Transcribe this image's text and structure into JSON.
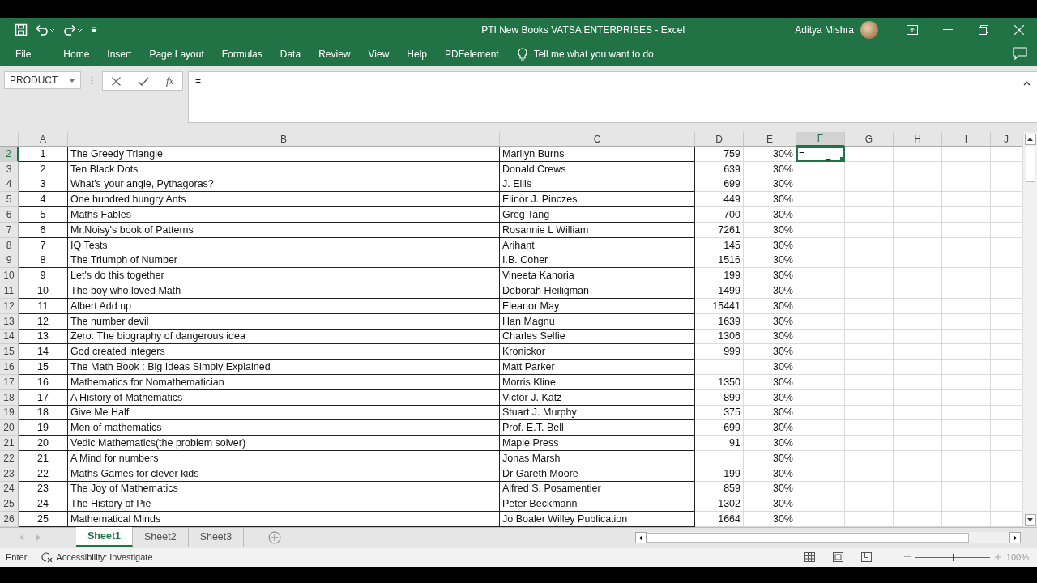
{
  "window": {
    "title": "PTI New Books VATSA ENTERPRISES  -  Excel",
    "user": "Aditya Mishra"
  },
  "ribbon_tabs": [
    {
      "label": "File"
    },
    {
      "label": "Home"
    },
    {
      "label": "Insert"
    },
    {
      "label": "Page Layout"
    },
    {
      "label": "Formulas"
    },
    {
      "label": "Data"
    },
    {
      "label": "Review"
    },
    {
      "label": "View"
    },
    {
      "label": "Help"
    },
    {
      "label": "PDFelement"
    }
  ],
  "tell_me": {
    "placeholder": "Tell me what you want to do"
  },
  "formula_bar": {
    "name_box": "PRODUCT",
    "function_label": "fx",
    "value": "="
  },
  "columns": [
    {
      "label": "A",
      "selected": false
    },
    {
      "label": "B",
      "selected": false
    },
    {
      "label": "C",
      "selected": false
    },
    {
      "label": "D",
      "selected": false
    },
    {
      "label": "E",
      "selected": false
    },
    {
      "label": "F",
      "selected": true
    },
    {
      "label": "G",
      "selected": false
    },
    {
      "label": "H",
      "selected": false
    },
    {
      "label": "I",
      "selected": false
    },
    {
      "label": "J",
      "selected": false
    }
  ],
  "active_cell": {
    "value": "="
  },
  "rows": [
    {
      "number": "2",
      "selected": true,
      "cells": {
        "a": "1",
        "b": "The Greedy Triangle",
        "c": "Marilyn Burns",
        "d": "759",
        "e": "30%"
      }
    },
    {
      "number": "3",
      "selected": false,
      "cells": {
        "a": "2",
        "b": "Ten Black Dots",
        "c": "Donald Crews",
        "d": "639",
        "e": "30%"
      }
    },
    {
      "number": "4",
      "selected": false,
      "cells": {
        "a": "3",
        "b": "What's your angle, Pythagoras?",
        "c": "J. Ellis",
        "d": "699",
        "e": "30%"
      }
    },
    {
      "number": "5",
      "selected": false,
      "cells": {
        "a": "4",
        "b": "One hundred hungry Ants",
        "c": "Elinor J. Pinczes",
        "d": "449",
        "e": "30%"
      }
    },
    {
      "number": "6",
      "selected": false,
      "cells": {
        "a": "5",
        "b": "Maths Fables",
        "c": "Greg Tang",
        "d": "700",
        "e": "30%"
      }
    },
    {
      "number": "7",
      "selected": false,
      "cells": {
        "a": "6",
        "b": "Mr.Noisy's book of Patterns",
        "c": "Rosannie L William",
        "d": "7261",
        "e": "30%"
      }
    },
    {
      "number": "8",
      "selected": false,
      "cells": {
        "a": "7",
        "b": "IQ Tests",
        "c": "Arihant",
        "d": "145",
        "e": "30%"
      }
    },
    {
      "number": "9",
      "selected": false,
      "cells": {
        "a": "8",
        "b": "The Triumph of Number",
        "c": "I.B. Coher",
        "d": "1516",
        "e": "30%"
      }
    },
    {
      "number": "10",
      "selected": false,
      "cells": {
        "a": "9",
        "b": "Let's do this together",
        "c": "Vineeta Kanoria",
        "d": "199",
        "e": "30%"
      }
    },
    {
      "number": "11",
      "selected": false,
      "cells": {
        "a": "10",
        "b": "The boy who loved Math",
        "c": "Deborah Heiligman",
        "d": "1499",
        "e": "30%"
      }
    },
    {
      "number": "12",
      "selected": false,
      "cells": {
        "a": "11",
        "b": "Albert Add up",
        "c": "Eleanor May",
        "d": "15441",
        "e": "30%"
      }
    },
    {
      "number": "13",
      "selected": false,
      "cells": {
        "a": "12",
        "b": "The number devil",
        "c": "Han Magnu",
        "d": "1639",
        "e": "30%"
      }
    },
    {
      "number": "14",
      "selected": false,
      "cells": {
        "a": "13",
        "b": "Zero: The biography of dangerous idea",
        "c": "Charles Selfie",
        "d": "1306",
        "e": "30%"
      }
    },
    {
      "number": "15",
      "selected": false,
      "cells": {
        "a": "14",
        "b": "God created integers",
        "c": "Kronickor",
        "d": "999",
        "e": "30%"
      }
    },
    {
      "number": "16",
      "selected": false,
      "cells": {
        "a": "15",
        "b": "The Math Book : Big Ideas Simply Explained",
        "c": "Matt Parker",
        "e": "30%"
      }
    },
    {
      "number": "17",
      "selected": false,
      "cells": {
        "a": "16",
        "b": "Mathematics for Nomathematician",
        "c": "Morris Kline",
        "d": "1350",
        "e": "30%"
      }
    },
    {
      "number": "18",
      "selected": false,
      "cells": {
        "a": "17",
        "b": "A History of Mathematics",
        "c": "Victor J. Katz",
        "d": "899",
        "e": "30%"
      }
    },
    {
      "number": "19",
      "selected": false,
      "cells": {
        "a": "18",
        "b": "Give Me Half",
        "c": "Stuart J. Murphy",
        "d": "375",
        "e": "30%"
      }
    },
    {
      "number": "20",
      "selected": false,
      "cells": {
        "a": "19",
        "b": "Men of mathematics",
        "c": "Prof. E.T. Bell",
        "d": "699",
        "e": "30%"
      }
    },
    {
      "number": "21",
      "selected": false,
      "cells": {
        "a": "20",
        "b": "Vedic Mathematics(the problem solver)",
        "c": "Maple Press",
        "d": "91",
        "e": "30%"
      }
    },
    {
      "number": "22",
      "selected": false,
      "cells": {
        "a": "21",
        "b": "A Mind for numbers",
        "c": "Jonas Marsh",
        "e": "30%"
      }
    },
    {
      "number": "23",
      "selected": false,
      "cells": {
        "a": "22",
        "b": "Maths Games for clever kids",
        "c": "Dr Gareth Moore",
        "d": "199",
        "e": "30%"
      }
    },
    {
      "number": "24",
      "selected": false,
      "cells": {
        "a": "23",
        "b": "The Joy of Mathematics",
        "c": "Alfred S. Posamentier",
        "d": "859",
        "e": "30%"
      }
    },
    {
      "number": "25",
      "selected": false,
      "cells": {
        "a": "24",
        "b": "The History of Pie",
        "c": "Peter Beckmann",
        "d": "1302",
        "e": "30%"
      }
    },
    {
      "number": "26",
      "selected": false,
      "cells": {
        "a": "25",
        "b": "Mathematical Minds",
        "c": "Jo Boaler Willey Publication",
        "d": "1664",
        "e": "30%"
      }
    }
  ],
  "sheets": [
    {
      "label": "Sheet1",
      "selected": true
    },
    {
      "label": "Sheet2",
      "selected": false
    },
    {
      "label": "Sheet3",
      "selected": false
    }
  ],
  "status_bar": {
    "mode": "Enter",
    "accessibility": "Accessibility: Investigate",
    "zoom": {
      "level": 0.5,
      "reading": "100%"
    }
  }
}
